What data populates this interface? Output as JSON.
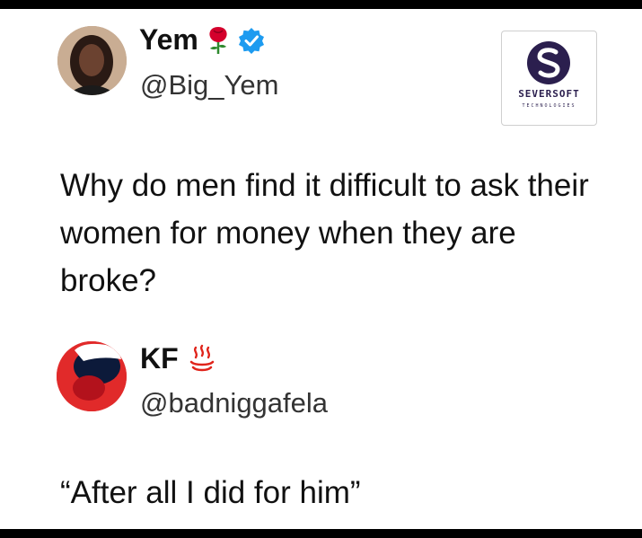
{
  "tweet1": {
    "display_name": "Yem",
    "name_emoji": "rose-icon",
    "verified": true,
    "handle": "@Big_Yem",
    "text": "Why do men find it difficult to ask their women for money when they are broke?"
  },
  "watermark": {
    "brand": "SEVERSOFT",
    "tagline": "TECHNOLOGIES",
    "colors": {
      "primary": "#2b1f4e"
    }
  },
  "tweet2": {
    "display_name": "KF",
    "name_emoji": "hot-springs-icon",
    "handle": "@badniggafela",
    "text": "“After all I did for him”"
  },
  "colors": {
    "verified_blue": "#1d9bf0",
    "rose_red": "#d4002c",
    "avatar2_red": "#e12a2a"
  }
}
